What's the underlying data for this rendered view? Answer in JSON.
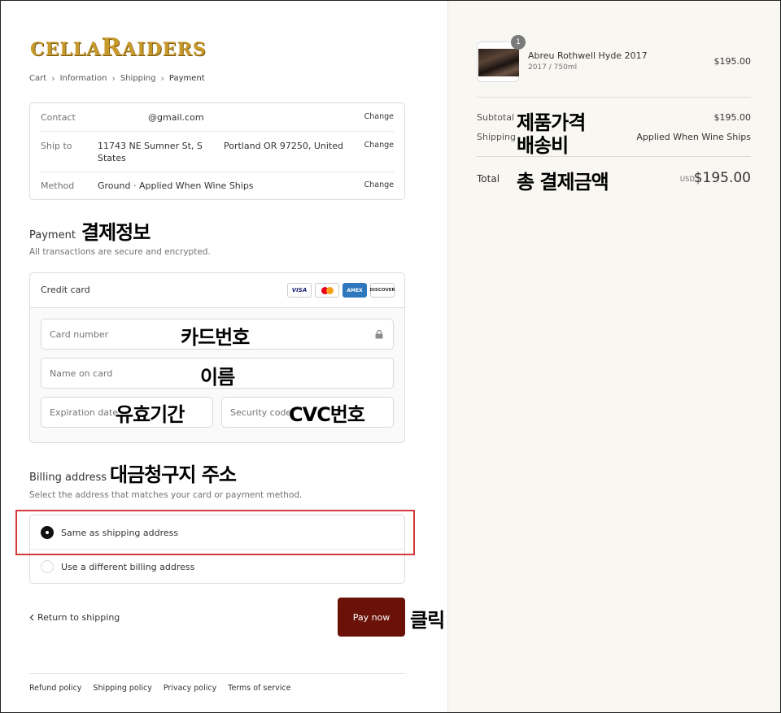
{
  "logo": {
    "part1": "CELLA",
    "part2": "R",
    "part3": "AIDERS"
  },
  "breadcrumb": {
    "cart": "Cart",
    "information": "Information",
    "shipping": "Shipping",
    "payment": "Payment",
    "separator": "›"
  },
  "info": {
    "contact_label": "Contact",
    "contact_value": "@gmail.com",
    "shipto_label": "Ship to",
    "shipto_line1": "11743 NE Sumner St, S",
    "shipto_line2": "States",
    "shipto_mid": "Portland OR 97250, United",
    "method_label": "Method",
    "method_prefix": "Ground · ",
    "method_value": "Applied When Wine Ships",
    "change_label": "Change"
  },
  "payment": {
    "title": "Payment",
    "subtitle": "All transactions are secure and encrypted.",
    "annotation": "결제정보",
    "credit_card_label": "Credit card",
    "brands": {
      "visa": "VISA",
      "amex": "AMEX",
      "discover": "DISCOVER"
    },
    "card_number_placeholder": "Card number",
    "card_number_annotation": "카드번호",
    "name_placeholder": "Name on card",
    "name_annotation": "이름",
    "expiration_placeholder": "Expiration date",
    "expiration_annotation": "유효기간",
    "security_placeholder": "Security code",
    "security_annotation": "CVC번호"
  },
  "billing": {
    "title": "Billing address",
    "annotation": "대금청구지 주소",
    "subtitle": "Select the address that matches your card or payment method.",
    "option_same": "Same as shipping address",
    "option_different": "Use a different billing address"
  },
  "actions": {
    "return_label": "Return to shipping",
    "pay_label": "Pay now",
    "pay_annotation": "클릭"
  },
  "footer": {
    "links": [
      "Refund policy",
      "Shipping policy",
      "Privacy policy",
      "Terms of service"
    ]
  },
  "summary": {
    "quantity": "1",
    "product_name": "Abreu Rothwell Hyde 2017",
    "product_sub": "2017 / 750ml",
    "product_price": "$195.00",
    "subtotal_label": "Subtotal",
    "subtotal_annotation": "제품가격",
    "subtotal_value": "$195.00",
    "shipping_label": "Shipping",
    "shipping_annotation": "배송비",
    "shipping_value": "Applied When Wine Ships",
    "total_label": "Total",
    "total_annotation": "총 결제금액",
    "total_currency": "USD",
    "total_value": "$195.00"
  },
  "colors": {
    "pay_button": "#6b1208",
    "highlight_box": "#d33a3a",
    "logo_gold": "#c79a2b"
  }
}
